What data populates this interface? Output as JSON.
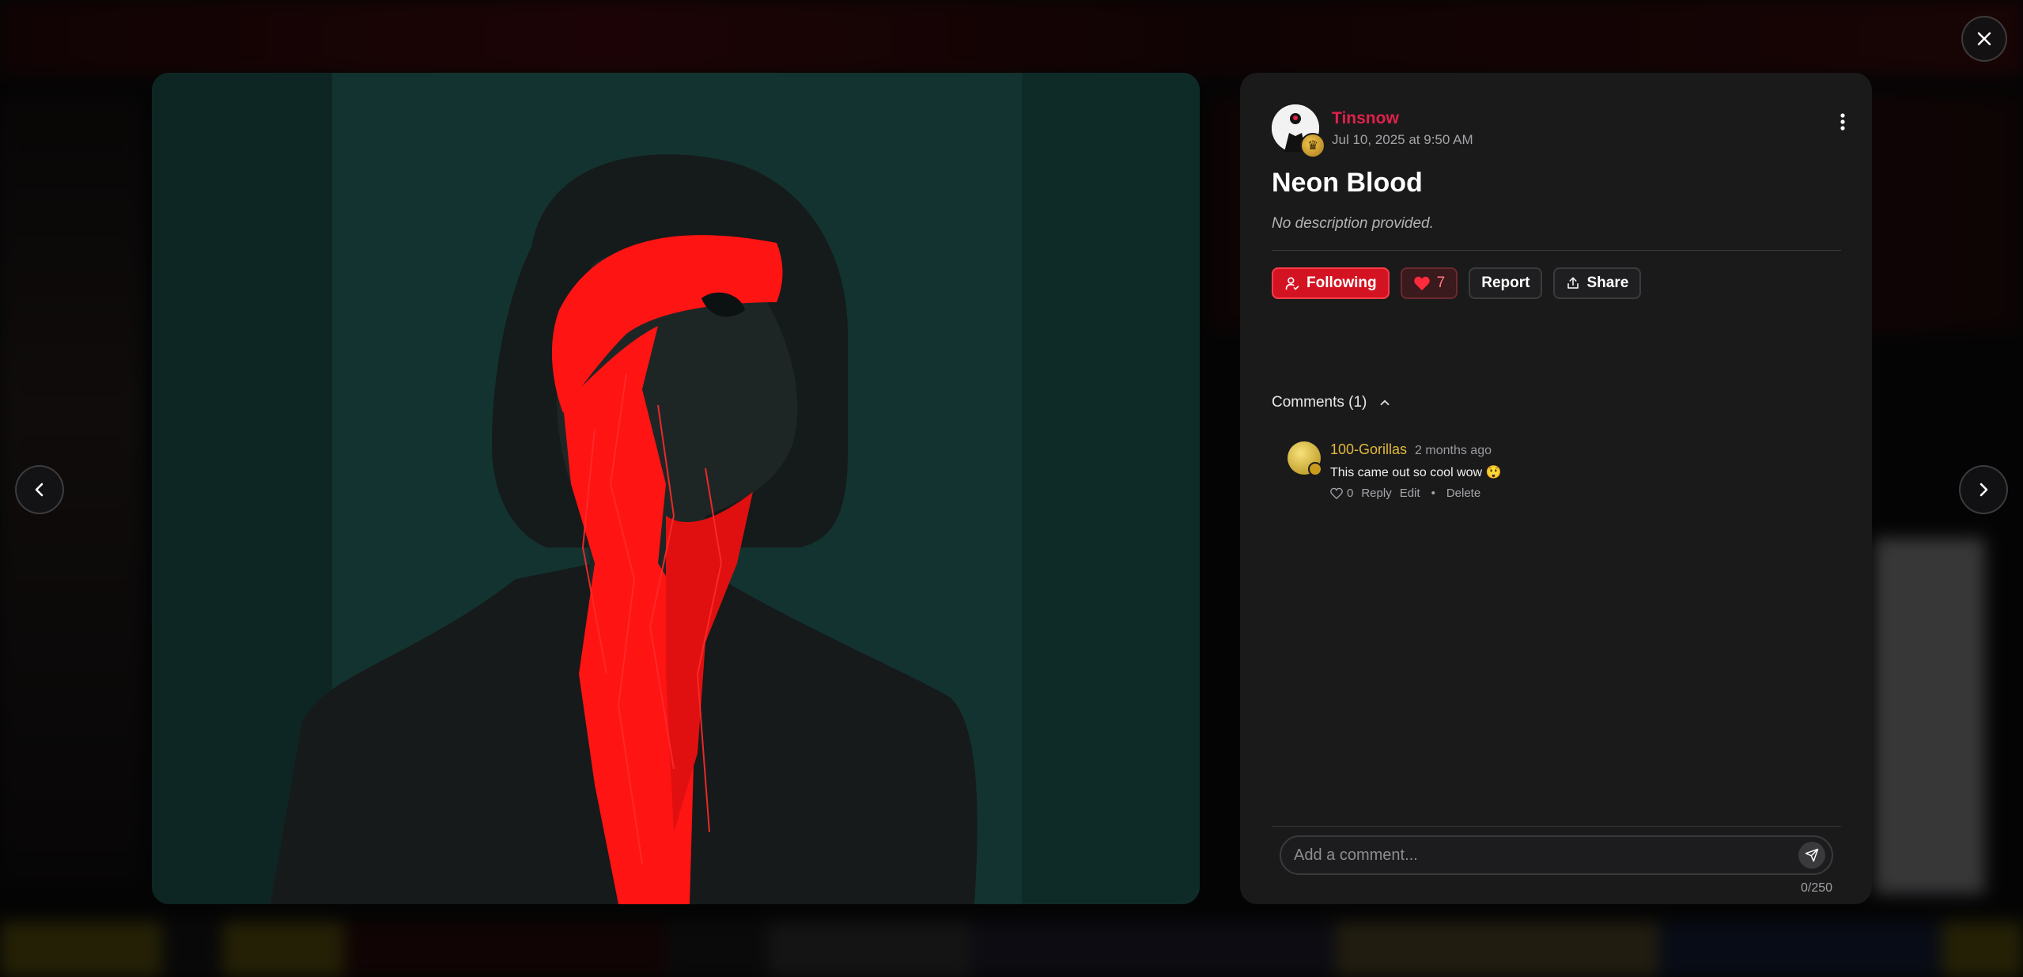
{
  "post": {
    "author": "Tinsnow",
    "date": "Jul 10, 2025 at 9:50 AM",
    "title": "Neon Blood",
    "description": "No description provided."
  },
  "actions": {
    "follow_label": "Following",
    "like_count": "7",
    "report_label": "Report",
    "share_label": "Share"
  },
  "comments": {
    "header": "Comments (1)",
    "items": [
      {
        "user": "100-Gorillas",
        "time": "2 months ago",
        "text": "This came out so cool wow 😲",
        "likes": "0",
        "reply_label": "Reply",
        "edit_label": "Edit",
        "separator": "•",
        "delete_label": "Delete"
      }
    ]
  },
  "composer": {
    "placeholder": "Add a comment...",
    "char_count": "0/250"
  },
  "colors": {
    "accent_red": "#e0214a",
    "follow_red": "#d31322",
    "gold": "#e2b93a",
    "panel_bg": "#1a1a1b",
    "image_bg": "#0f2a27"
  },
  "icons": {
    "close": "close-icon",
    "prev": "chevron-left-icon",
    "next": "chevron-right-icon",
    "more": "more-vertical-icon",
    "follow": "user-check-icon",
    "like": "heart-icon",
    "share": "share-icon",
    "collapse": "chevron-up-icon",
    "send": "send-icon"
  }
}
